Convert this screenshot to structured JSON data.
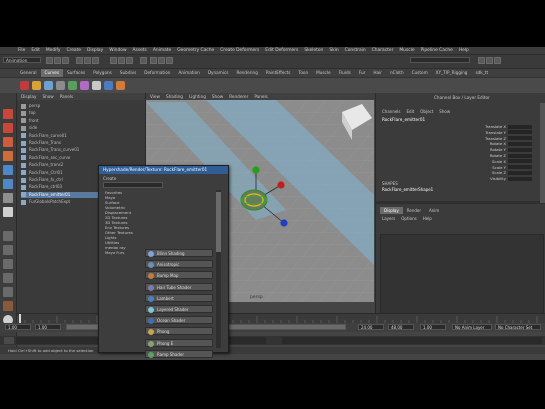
{
  "menubar": [
    "File",
    "Edit",
    "Modify",
    "Create",
    "Display",
    "Window",
    "Assets",
    "Animate",
    "Geometry Cache",
    "Create Deformers",
    "Edit Deformers",
    "Skeleton",
    "Skin",
    "Constrain",
    "Character",
    "Muscle",
    "Pipeline Cache",
    "Help"
  ],
  "mode": "Animation",
  "shelf_tabs": [
    "General",
    "Curves",
    "Surfaces",
    "Polygons",
    "Subdivs",
    "Deformation",
    "Animation",
    "Dynamics",
    "Rendering",
    "PaintEffects",
    "Toon",
    "Muscle",
    "Fluids",
    "Fur",
    "Hair",
    "nCloth",
    "Custom",
    "XY_TIP_Rigging",
    "sdk_tt"
  ],
  "active_shelf_tab": "Curves",
  "outliner": {
    "menus": [
      "Display",
      "Show",
      "Panels"
    ],
    "items": [
      "persp",
      "top",
      "front",
      "side",
      "RockFlare_curve01",
      "RockFlare_Trans",
      "RockFlare_Trans_curve01",
      "RockFlare_sec_curve",
      "RockFlare_trans2",
      "RockFlare_Ctrl01",
      "RockFlare_fx_ctrl",
      "RockFlare_ctrl03",
      "RockFlare_emitter01",
      "FurGlobalsPatchExpt"
    ],
    "selected_index": 12
  },
  "viewport": {
    "menus": [
      "View",
      "Shading",
      "Lighting",
      "Show",
      "Renderer",
      "Panels"
    ],
    "camera_label": "persp"
  },
  "hypershade": {
    "title": "Hypershade/Render/Texture: RockFlare_emitter01",
    "search_label": "Create",
    "nav": [
      "Favorites",
      "Maya",
      "Surface",
      "Volumetric",
      "Displacement",
      "2D Textures",
      "3D Textures",
      "Env Textures",
      "Other Textures",
      "Lights",
      "Utilities",
      "mental ray",
      "Maya Furs"
    ],
    "materials": [
      "Blinn Shading",
      "Anisotropic",
      "Bump Map",
      "Hair Tube Shader",
      "Lambert",
      "Layered Shader",
      "Ocean Shader",
      "Phong",
      "Phong E",
      "Ramp Shader",
      "Shading Map",
      "Surface Shader",
      "Use Background",
      "Envelope"
    ],
    "swatch_colors": [
      "#7fa3d8",
      "#6c8fb7",
      "#c07d3e",
      "#7b7bb0",
      "#4a7fc8",
      "#7fc4d8",
      "#3e6fb0",
      "#c8a44a",
      "#8aa06e",
      "#5aa060",
      "#a07ec8",
      "#6a6a6a",
      "#d06a4a",
      "#4a90c8"
    ]
  },
  "channelbox": {
    "title": "Channel Box / Layer Editor",
    "menus": [
      "Channels",
      "Edit",
      "Object",
      "Show"
    ],
    "node": "RockFlare_emitter01",
    "attributes": [
      "Translate X",
      "Translate Y",
      "Translate Z",
      "Rotate X",
      "Rotate Y",
      "Rotate Z",
      "Scale X",
      "Scale Y",
      "Scale Z",
      "Visibility"
    ],
    "shapes_label": "SHAPES",
    "shape_node": "RockFlare_emitterShape1",
    "layer_tabs": [
      "Display",
      "Render",
      "Anim"
    ],
    "layer_menus": [
      "Layers",
      "Options",
      "Help"
    ]
  },
  "range": {
    "start": "1.00",
    "end": "1.00",
    "anim_start": "1.00",
    "anim_end": "1.00",
    "min": "24.00",
    "max": "48.00",
    "current": "1.00",
    "anim_layer": "No Anim Layer",
    "character_set": "No Character Set"
  },
  "help_line": "Hold Ctrl+Shift to add object to the selection"
}
